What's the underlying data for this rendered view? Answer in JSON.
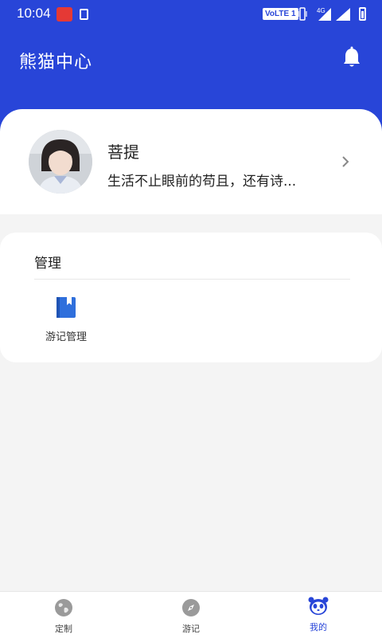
{
  "status_bar": {
    "time": "10:04",
    "volte": "VoLTE 1",
    "network": "4G"
  },
  "header": {
    "title": "熊猫中心",
    "bell_icon": "bell-icon"
  },
  "profile": {
    "name": "菩提",
    "motto": "生活不止眼前的苟且，还有诗..."
  },
  "management": {
    "heading": "管理",
    "items": [
      {
        "label": "游记管理",
        "icon": "book-icon"
      }
    ]
  },
  "bottom_nav": {
    "tabs": [
      {
        "label": "定制",
        "icon": "globe-icon",
        "active": false
      },
      {
        "label": "游记",
        "icon": "compass-icon",
        "active": false
      },
      {
        "label": "我的",
        "icon": "panda-icon",
        "active": true
      }
    ]
  },
  "colors": {
    "primary": "#2845d8",
    "background": "#f4f4f4"
  }
}
